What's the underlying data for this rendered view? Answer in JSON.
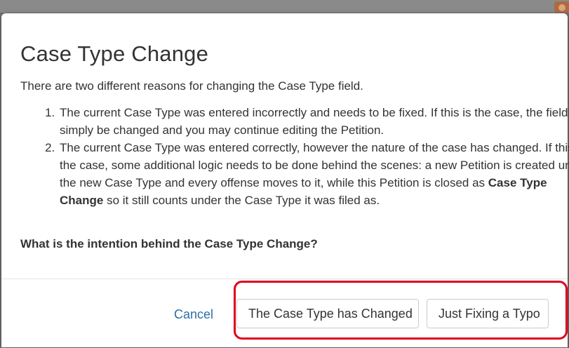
{
  "modal": {
    "title": "Case Type Change",
    "intro": "There are two different reasons for changing the Case Type field.",
    "reasons": [
      {
        "text": "The current Case Type was entered incorrectly and needs to be fixed. If this is the case, the field will simply be changed and you may continue editing the Petition."
      },
      {
        "text_before": "The current Case Type was entered correctly, however the nature of the case has changed. If this is the case, some additional logic needs to be done behind the scenes: a new Petition is created under the new Case Type and every offense moves to it, while this Petition is closed as ",
        "emphasis": "Case Type Change",
        "text_after": " so it still counts under the Case Type it was filed as."
      }
    ],
    "question": "What is the intention behind the Case Type Change?"
  },
  "footer": {
    "cancel_label": "Cancel",
    "changed_label": "The Case Type has Changed",
    "typo_label": "Just Fixing a Typo"
  },
  "colors": {
    "link": "#2a6fa8",
    "highlight": "#e0001b",
    "text": "#333333"
  }
}
